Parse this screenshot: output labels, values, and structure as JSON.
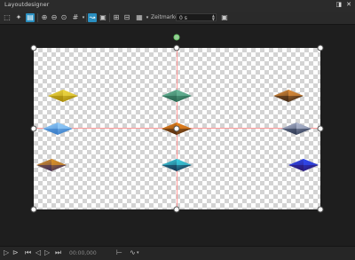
{
  "window": {
    "title": "Layoutdesigner",
    "pin_icon": "pin-icon",
    "close_icon": "close-icon"
  },
  "toolbar": {
    "zoom_label": "Zeitmarke:",
    "time_value": "0 s"
  },
  "playback": {
    "time": "00:00,000"
  },
  "colors": {
    "accent": "#2a8fc0",
    "guide": "#ff9a9a",
    "rotate_handle": "#99cc99"
  },
  "objects": [
    {
      "name": "diamond-yellow",
      "c1": "#f5e04a",
      "c2": "#9a7b00"
    },
    {
      "name": "diamond-green",
      "c1": "#6fbfa0",
      "c2": "#205a45"
    },
    {
      "name": "diamond-orange-dark",
      "c1": "#f09a40",
      "c2": "#2a1a10"
    },
    {
      "name": "diamond-blue-light",
      "c1": "#9fd6ff",
      "c2": "#2a6fc0"
    },
    {
      "name": "diamond-orange-center",
      "c1": "#ff9020",
      "c2": "#3a2010"
    },
    {
      "name": "diamond-navy",
      "c1": "#c0c8e0",
      "c2": "#1a2540"
    },
    {
      "name": "diamond-gold-dark",
      "c1": "#f0a020",
      "c2": "#2a2060"
    },
    {
      "name": "diamond-cyan",
      "c1": "#40e0f0",
      "c2": "#102040"
    },
    {
      "name": "diamond-blue-purple",
      "c1": "#3050ff",
      "c2": "#2a1060"
    }
  ]
}
